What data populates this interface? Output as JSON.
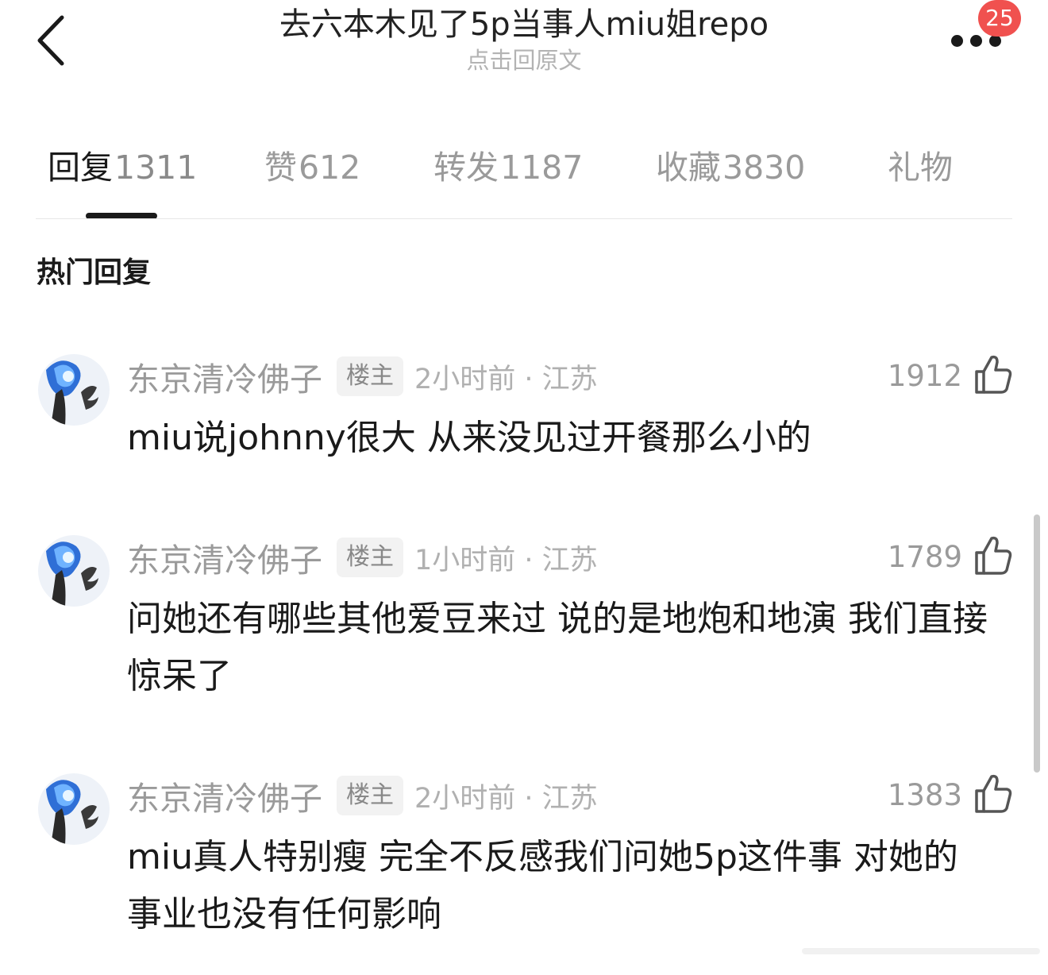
{
  "header": {
    "back_icon": "chevron-left-icon",
    "title": "去六本木见了5p当事人miu姐repo",
    "subtitle": "点击回原文",
    "more_icon": "more-dots-icon",
    "notification_badge": "25"
  },
  "tabs": [
    {
      "label": "回复",
      "count": "1311",
      "active": true
    },
    {
      "label": "赞",
      "count": "612",
      "active": false
    },
    {
      "label": "转发",
      "count": "1187",
      "active": false
    },
    {
      "label": "收藏",
      "count": "3830",
      "active": false
    },
    {
      "label": "礼物",
      "count": "",
      "active": false
    }
  ],
  "section_title": "热门回复",
  "comments": [
    {
      "username": "东京清冷佛子",
      "tag": "楼主",
      "time_location": "2小时前 · 江苏",
      "likes": "1912",
      "text": "miu说johnny很大 从来没见过开餐那么小的"
    },
    {
      "username": "东京清冷佛子",
      "tag": "楼主",
      "time_location": "1小时前 · 江苏",
      "likes": "1789",
      "text": "问她还有哪些其他爱豆来过 说的是地炮和地演 我们直接惊呆了"
    },
    {
      "username": "东京清冷佛子",
      "tag": "楼主",
      "time_location": "2小时前 · 江苏",
      "likes": "1383",
      "text": "miu真人特别瘦 完全不反感我们问她5p这件事 对她的事业也没有任何影响"
    }
  ],
  "colors": {
    "badge": "#f0514f",
    "text_primary": "#1a1a1a",
    "text_secondary": "#9a9a9a",
    "tag_background": "#f2f2f2"
  }
}
